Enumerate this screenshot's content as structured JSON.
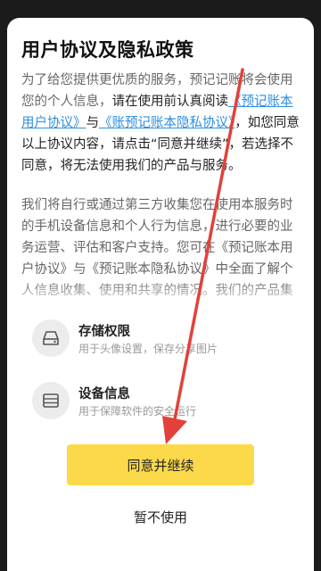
{
  "dialog": {
    "title": "用户协议及隐私政策",
    "paragraph1": {
      "lead": "为了给您提供更优质的服务，预记记账将会使用您的个人信息，",
      "emphasis": "请在使用前认真阅读",
      "link_user_agreement": "《预记账本用户协议》",
      "conj": "与",
      "link_privacy": "《账预记账本隐私协议》",
      "emphasis2": "，如您同意以上协议内容，请点击“同意并继续”，若选择不同意，将无法使用我们的产品与服务。"
    },
    "paragraph2": "我们将自行或通过第三方收集您在使用本服务时的手机设备信息和个人行为信息，进行必要的业务运营、评估和客户支持。您可在《预记账本用户协议》与《预记账本隐私协议》中全面了解个人信息收集、使用和共享的情况。我们的产品集成友盟",
    "permissions": [
      {
        "title": "存储权限",
        "desc": "用于头像设置，保存分享图片",
        "icon": "storage-drive-icon"
      },
      {
        "title": "设备信息",
        "desc": "用于保障软件的安全运行",
        "icon": "device-info-icon"
      }
    ],
    "agree_label": "同意并继续",
    "decline_label": "暂不使用"
  },
  "colors": {
    "accent_button": "#fcd94a",
    "link": "#2e8fe0",
    "annotation_arrow": "#e2413a"
  }
}
